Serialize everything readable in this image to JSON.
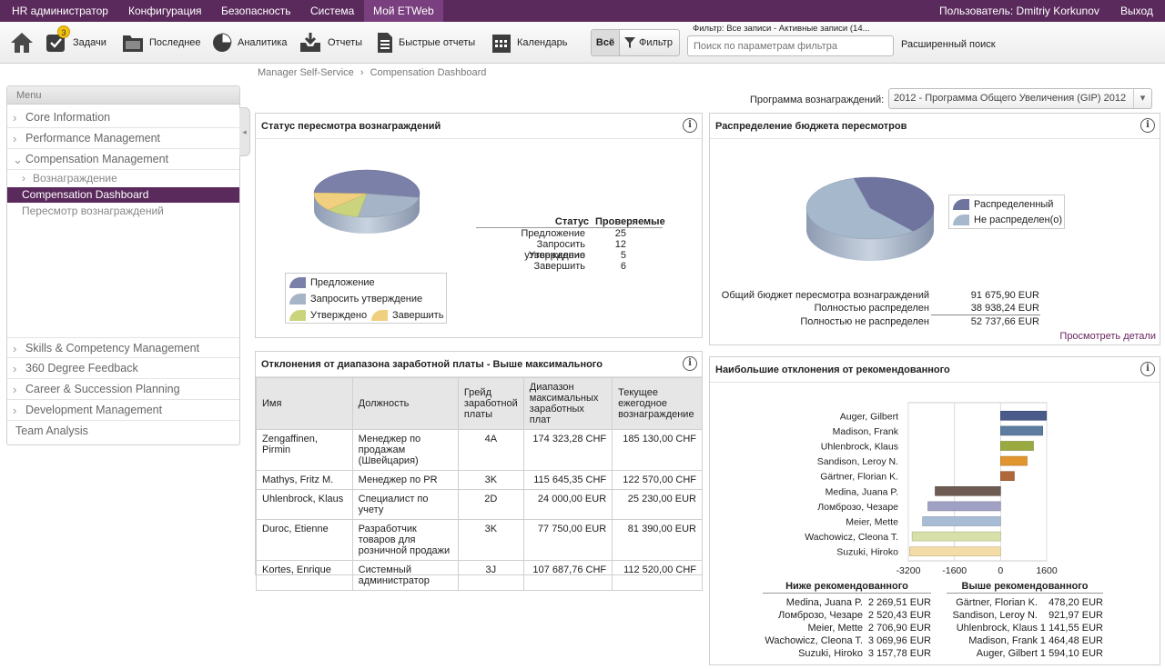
{
  "topbar": {
    "menus": [
      "HR администратор",
      "Конфигурация",
      "Безопасность",
      "Система",
      "Мой ETWeb"
    ],
    "user": "Пользователь: Dmitriy Korkunov",
    "logout": "Выход"
  },
  "toolbar": {
    "tasks_label": "Задачи",
    "tasks_badge": "3",
    "recent_label": "Последнее",
    "analytics_label": "Аналитика",
    "reports_label": "Отчеты",
    "quick_reports_label": "Быстрые отчеты",
    "calendar_label": "Календарь",
    "all_label": "Всё",
    "filter_label": "Фильтр",
    "filter_status": "Фильтр: Все записи - Активные записи (14...",
    "search_placeholder": "Поиск по параметрам фильтра",
    "advanced_search": "Расширенный поиск"
  },
  "breadcrumb": {
    "first": "Manager Self-Service",
    "separator": "›",
    "second": "Compensation Dashboard"
  },
  "program": {
    "label": "Программа вознаграждений:",
    "value": "2012 - Программа Общего Увеличения (GIP) 2012"
  },
  "sidebar": {
    "title": "Menu",
    "items": [
      "Core Information",
      "Performance Management",
      "Compensation Management"
    ],
    "sub_group": "Вознаграждение",
    "active": "Compensation Dashboard",
    "sub_item": "Пересмотр вознаграждений",
    "lower_items": [
      "Skills & Competency Management",
      "360 Degree Feedback",
      "Career & Succession Planning",
      "Development Management"
    ],
    "last_item": "Team Analysis"
  },
  "status_panel": {
    "title": "Статус пересмотра вознаграждений",
    "col_status": "Статус",
    "col_count": "Проверяемые",
    "rows": [
      {
        "status": "Предложение",
        "count": "25"
      },
      {
        "status": "Запросить утверждение",
        "count": "12"
      },
      {
        "status": "Утверждено",
        "count": "5"
      },
      {
        "status": "Завершить",
        "count": "6"
      }
    ],
    "legend": [
      "Предложение",
      "Запросить утверждение",
      "Утверждено",
      "Завершить"
    ]
  },
  "budget_panel": {
    "title": "Распределение бюджета пересмотров",
    "legend": [
      "Распределенный",
      "Не распределен(о)"
    ],
    "rows": [
      {
        "label": "Общий бюджет пересмотра вознаграждений",
        "value": "91 675,90 EUR"
      },
      {
        "label": "Полностью распределен",
        "value": "38 938,24 EUR"
      },
      {
        "label": "Полностью не распределен",
        "value": "52 737,66 EUR"
      }
    ],
    "details_link": "Просмотреть детали"
  },
  "salary_panel": {
    "title": "Отклонения от диапазона заработной платы - Выше максимального",
    "headers": [
      "Имя",
      "Должность",
      "Грейд заработной платы",
      "Диапазон максимальных заработных плат",
      "Текущее ежегодное вознаграждение"
    ],
    "rows": [
      [
        "Zengaffinen, Pirmin",
        "Менеджер по продажам (Швейцария)",
        "4A",
        "174 323,28 CHF",
        "185 130,00 CHF"
      ],
      [
        "Mathys, Fritz M.",
        "Менеджер по PR",
        "3K",
        "115 645,35 CHF",
        "122 570,00 CHF"
      ],
      [
        "Uhlenbrock, Klaus",
        "Специалист по учету",
        "2D",
        "24 000,00 EUR",
        "25 230,00 EUR"
      ],
      [
        "Duroc, Etienne",
        "Разработчик товаров для розничной продажи",
        "3K",
        "77 750,00 EUR",
        "81 390,00 EUR"
      ],
      [
        "Kortes, Enrique",
        "Системный администратор",
        "3J",
        "107 687,76 CHF",
        "112 520,00 CHF"
      ]
    ]
  },
  "deviation_panel": {
    "title": "Наибольшие отклонения от рекомендованного",
    "below_title": "Ниже рекомендованного",
    "above_title": "Выше рекомендованного",
    "below": [
      {
        "name": "Medina, Juana P.",
        "value": "2 269,51 EUR"
      },
      {
        "name": "Ломброзо, Чезаре",
        "value": "2 520,43 EUR"
      },
      {
        "name": "Meier, Mette",
        "value": "2 706,90 EUR"
      },
      {
        "name": "Wachowicz, Cleona T.",
        "value": "3 069,96 EUR"
      },
      {
        "name": "Suzuki, Hiroko",
        "value": "3 157,78 EUR"
      }
    ],
    "above": [
      {
        "name": "Gärtner, Florian K.",
        "value": "478,20 EUR"
      },
      {
        "name": "Sandison, Leroy N.",
        "value": "921,97 EUR"
      },
      {
        "name": "Uhlenbrock, Klaus",
        "value": "1 141,55 EUR"
      },
      {
        "name": "Madison, Frank",
        "value": "1 464,48 EUR"
      },
      {
        "name": "Auger, Gilbert",
        "value": "1 594,10 EUR"
      }
    ]
  },
  "chart_data": [
    {
      "type": "pie",
      "categories": [
        "Предложение",
        "Запросить утверждение",
        "Утверждено",
        "Завершить"
      ],
      "values": [
        25,
        12,
        5,
        6
      ],
      "colors": [
        "#7b80a8",
        "#a6b4c8",
        "#c9d47c",
        "#f0cf7e"
      ],
      "legend": "bottom"
    },
    {
      "type": "pie",
      "categories": [
        "Распределенный",
        "Не распределен(о)"
      ],
      "values": [
        38938.24,
        52737.66
      ],
      "colors": [
        "#6e749e",
        "#a6b8cc"
      ],
      "legend": "right"
    },
    {
      "type": "bar",
      "orientation": "horizontal",
      "categories": [
        "Auger, Gilbert",
        "Madison, Frank",
        "Uhlenbrock, Klaus",
        "Sandison, Leroy N.",
        "Gärtner, Florian K.",
        "Medina, Juana P.",
        "Ломброзо, Чезаре",
        "Meier, Mette",
        "Wachowicz, Cleona T.",
        "Suzuki, Hiroko"
      ],
      "values": [
        1594.1,
        1464.48,
        1141.55,
        921.97,
        478.2,
        -2269.51,
        -2520.43,
        -2706.9,
        -3069.96,
        -3157.78
      ],
      "colors": [
        "#4a5a8a",
        "#5c7ca0",
        "#9aaa40",
        "#e0952e",
        "#b0683a",
        "#6e5c54",
        "#a0a0c4",
        "#a8bcd6",
        "#d6e0a8",
        "#f4dca6"
      ],
      "xticks": [
        "-3200",
        "-1600",
        "0",
        "1600"
      ],
      "xlim": [
        -3200,
        1600
      ],
      "grid": true
    }
  ]
}
